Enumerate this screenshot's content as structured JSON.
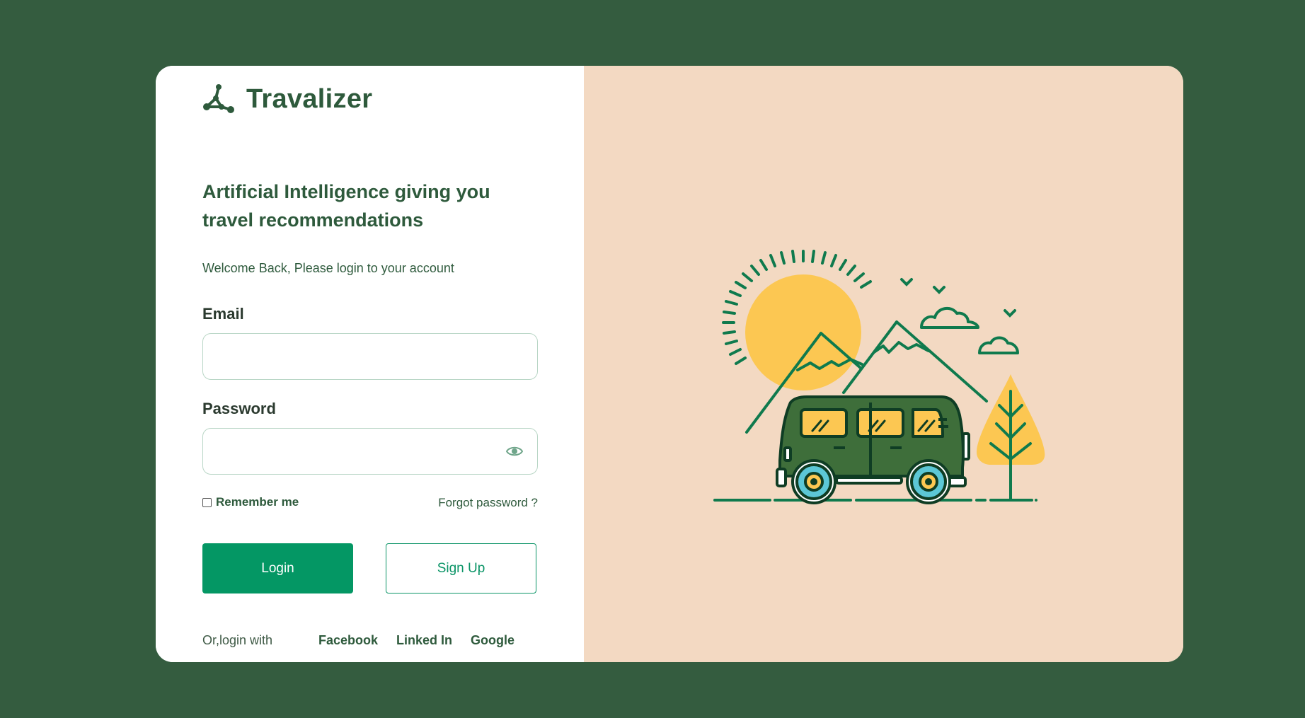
{
  "brand": {
    "name": "Travalizer",
    "logo_icon": "network-nodes-icon"
  },
  "headline": "Artificial Intelligence giving you travel recommendations",
  "welcome": "Welcome Back, Please login to your account",
  "form": {
    "email_label": "Email",
    "email_value": "",
    "password_label": "Password",
    "password_value": "",
    "password_toggle_icon": "eye-icon",
    "remember_label": "Remember me",
    "remember_checked": false,
    "forgot_label": "Forgot password ?",
    "login_label": "Login",
    "signup_label": "Sign Up"
  },
  "social": {
    "or_label": "Or,login with",
    "providers": [
      "Facebook",
      "Linked In",
      "Google"
    ]
  },
  "colors": {
    "page_background": "#345c3f",
    "card": "#ffffff",
    "illustration_panel": "#f3d9c2",
    "brand_green": "#2e5a3c",
    "accent_green": "#049764",
    "sun_yellow": "#fcc752",
    "van_green": "#3e6e3a",
    "wheel_cyan": "#5cc7d6"
  }
}
